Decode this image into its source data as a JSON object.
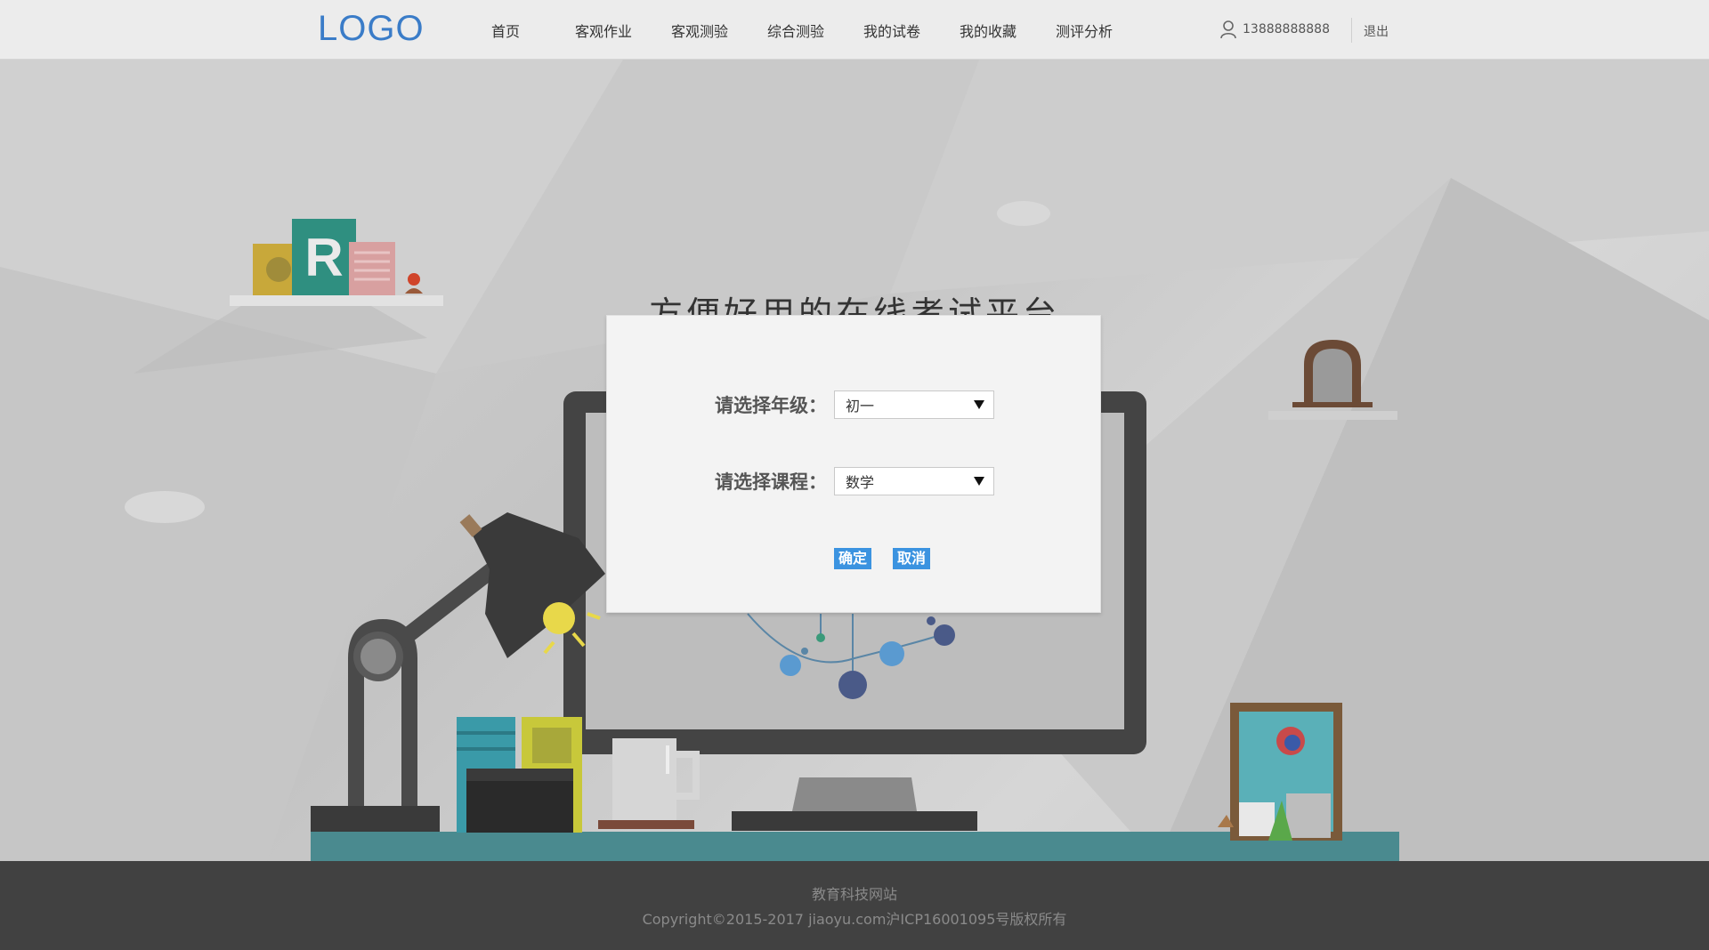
{
  "header": {
    "logo": "LOGO",
    "nav": [
      "首页",
      "客观作业",
      "客观测验",
      "综合测验",
      "我的试卷",
      "我的收藏",
      "测评分析"
    ],
    "user_phone": "13888888888",
    "logout": "退出"
  },
  "hero": {
    "headline": "方便好用的在线考试平台"
  },
  "dialog": {
    "grade_label": "请选择年级：",
    "grade_value": "初一",
    "course_label": "请选择课程：",
    "course_value": "数学",
    "confirm": "确定",
    "cancel": "取消"
  },
  "footer": {
    "site": "教育科技网站",
    "copyright": "Copyright©2015-2017 jiaoyu.com沪ICP16001095号版权所有"
  },
  "colors": {
    "logo": "#3a7cc8",
    "button": "#3b93e0",
    "footer_bg": "#414141",
    "desk": "#4a8a8f"
  }
}
